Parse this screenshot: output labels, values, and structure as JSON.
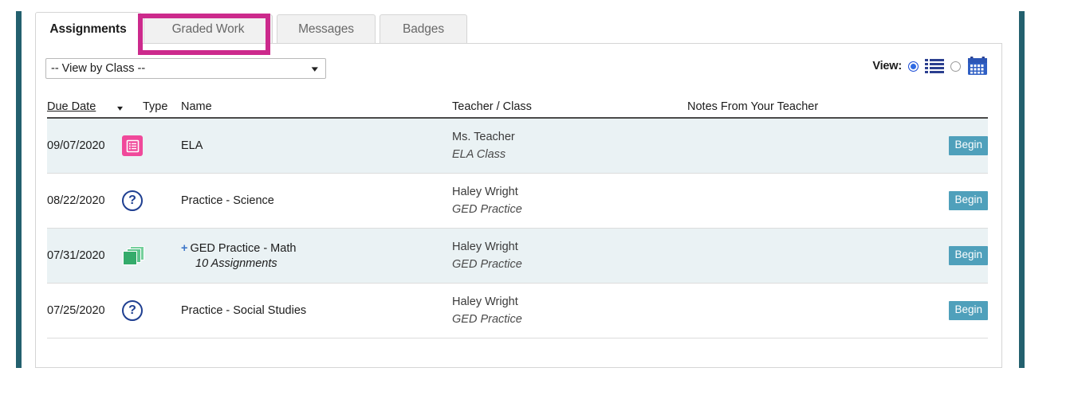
{
  "tabs": [
    {
      "label": "Assignments",
      "active": true
    },
    {
      "label": "Graded Work",
      "active": false
    },
    {
      "label": "Messages",
      "active": false
    },
    {
      "label": "Badges",
      "active": false
    }
  ],
  "toolbar": {
    "class_filter_value": "-- View by Class --",
    "view_label": "View:",
    "list_view_selected": true,
    "calendar_view_selected": false,
    "list_icon": "list-view-icon",
    "calendar_icon": "calendar-view-icon"
  },
  "table": {
    "headers": {
      "due_date": "Due Date",
      "sort_caret": "▾",
      "type": "Type",
      "name": "Name",
      "teacher_class": "Teacher / Class",
      "notes": "Notes From Your Teacher"
    },
    "rows": [
      {
        "due_date": "09/07/2020",
        "icon": "list-document-icon",
        "icon_color": "#f0499a",
        "name": "ELA",
        "expandable": false,
        "subtext": "",
        "teacher": "Ms. Teacher",
        "klass": "ELA Class",
        "notes": "",
        "action": "Begin"
      },
      {
        "due_date": "08/22/2020",
        "icon": "question-mark-icon",
        "icon_color": "#1f3f91",
        "name": "Practice - Science",
        "expandable": false,
        "subtext": "",
        "teacher": "Haley Wright",
        "klass": "GED Practice",
        "notes": "",
        "action": "Begin"
      },
      {
        "due_date": "07/31/2020",
        "icon": "stacked-cards-icon",
        "icon_color": "#34ab6b",
        "name": "GED Practice - Math",
        "expandable": true,
        "expand_symbol": "+",
        "subtext": "10 Assignments",
        "teacher": "Haley Wright",
        "klass": "GED Practice",
        "notes": "",
        "action": "Begin"
      },
      {
        "due_date": "07/25/2020",
        "icon": "question-mark-icon",
        "icon_color": "#1f3f91",
        "name": "Practice - Social Studies",
        "expandable": false,
        "subtext": "",
        "teacher": "Haley Wright",
        "klass": "GED Practice",
        "notes": "",
        "action": "Begin"
      }
    ]
  },
  "annotation": {
    "highlight_color": "#cc2a8c",
    "target": "Graded Work"
  },
  "colors": {
    "rail": "#23606e",
    "begin_button": "#4fa0bb",
    "alt_row": "#eaf2f4",
    "radio_on": "#2f6ae3"
  }
}
